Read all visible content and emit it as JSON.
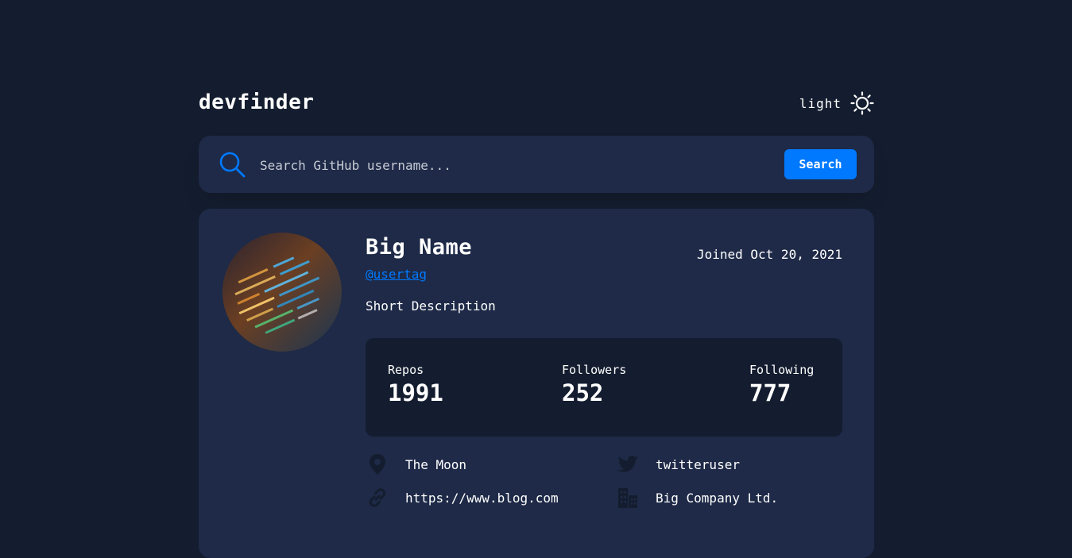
{
  "app": {
    "logo": "devfinder",
    "theme_label": "light",
    "theme_icon": "sun-icon"
  },
  "search": {
    "placeholder": "Search GitHub username...",
    "value": "",
    "button_label": "Search",
    "icon": "search-icon"
  },
  "profile": {
    "name": "Big Name",
    "tag": "@usertag",
    "joined": "Joined Oct 20, 2021",
    "bio": "Short Description",
    "avatar_icon": "avatar-image"
  },
  "stats": {
    "repos_label": "Repos",
    "repos_value": "1991",
    "followers_label": "Followers",
    "followers_value": "252",
    "following_label": "Following",
    "following_value": "777"
  },
  "links": {
    "location": "The Moon",
    "location_icon": "map-pin-icon",
    "twitter": "twitteruser",
    "twitter_icon": "twitter-icon",
    "blog": "https://www.blog.com",
    "blog_icon": "link-icon",
    "company": "Big Company Ltd.",
    "company_icon": "building-icon"
  },
  "colors": {
    "background": "#141d2f",
    "card": "#1e2a47",
    "accent": "#0079ff",
    "muted_icon": "#141d2f",
    "text": "#ffffff"
  }
}
